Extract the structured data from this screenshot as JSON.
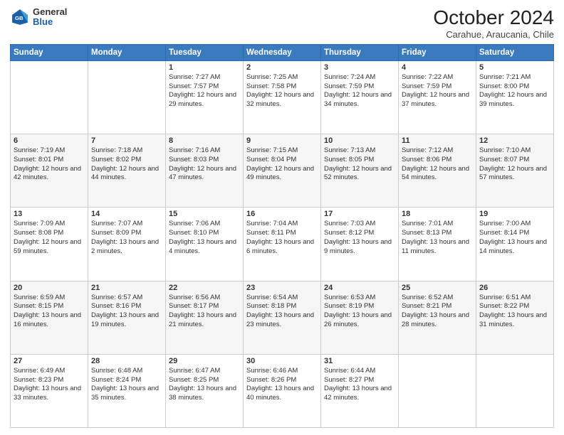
{
  "header": {
    "logo": {
      "line1": "General",
      "line2": "Blue"
    },
    "title": "October 2024",
    "subtitle": "Carahue, Araucania, Chile"
  },
  "weekdays": [
    "Sunday",
    "Monday",
    "Tuesday",
    "Wednesday",
    "Thursday",
    "Friday",
    "Saturday"
  ],
  "weeks": [
    [
      {
        "day": null,
        "sunrise": "",
        "sunset": "",
        "daylight": ""
      },
      {
        "day": null,
        "sunrise": "",
        "sunset": "",
        "daylight": ""
      },
      {
        "day": "1",
        "sunrise": "Sunrise: 7:27 AM",
        "sunset": "Sunset: 7:57 PM",
        "daylight": "Daylight: 12 hours and 29 minutes."
      },
      {
        "day": "2",
        "sunrise": "Sunrise: 7:25 AM",
        "sunset": "Sunset: 7:58 PM",
        "daylight": "Daylight: 12 hours and 32 minutes."
      },
      {
        "day": "3",
        "sunrise": "Sunrise: 7:24 AM",
        "sunset": "Sunset: 7:59 PM",
        "daylight": "Daylight: 12 hours and 34 minutes."
      },
      {
        "day": "4",
        "sunrise": "Sunrise: 7:22 AM",
        "sunset": "Sunset: 7:59 PM",
        "daylight": "Daylight: 12 hours and 37 minutes."
      },
      {
        "day": "5",
        "sunrise": "Sunrise: 7:21 AM",
        "sunset": "Sunset: 8:00 PM",
        "daylight": "Daylight: 12 hours and 39 minutes."
      }
    ],
    [
      {
        "day": "6",
        "sunrise": "Sunrise: 7:19 AM",
        "sunset": "Sunset: 8:01 PM",
        "daylight": "Daylight: 12 hours and 42 minutes."
      },
      {
        "day": "7",
        "sunrise": "Sunrise: 7:18 AM",
        "sunset": "Sunset: 8:02 PM",
        "daylight": "Daylight: 12 hours and 44 minutes."
      },
      {
        "day": "8",
        "sunrise": "Sunrise: 7:16 AM",
        "sunset": "Sunset: 8:03 PM",
        "daylight": "Daylight: 12 hours and 47 minutes."
      },
      {
        "day": "9",
        "sunrise": "Sunrise: 7:15 AM",
        "sunset": "Sunset: 8:04 PM",
        "daylight": "Daylight: 12 hours and 49 minutes."
      },
      {
        "day": "10",
        "sunrise": "Sunrise: 7:13 AM",
        "sunset": "Sunset: 8:05 PM",
        "daylight": "Daylight: 12 hours and 52 minutes."
      },
      {
        "day": "11",
        "sunrise": "Sunrise: 7:12 AM",
        "sunset": "Sunset: 8:06 PM",
        "daylight": "Daylight: 12 hours and 54 minutes."
      },
      {
        "day": "12",
        "sunrise": "Sunrise: 7:10 AM",
        "sunset": "Sunset: 8:07 PM",
        "daylight": "Daylight: 12 hours and 57 minutes."
      }
    ],
    [
      {
        "day": "13",
        "sunrise": "Sunrise: 7:09 AM",
        "sunset": "Sunset: 8:08 PM",
        "daylight": "Daylight: 12 hours and 59 minutes."
      },
      {
        "day": "14",
        "sunrise": "Sunrise: 7:07 AM",
        "sunset": "Sunset: 8:09 PM",
        "daylight": "Daylight: 13 hours and 2 minutes."
      },
      {
        "day": "15",
        "sunrise": "Sunrise: 7:06 AM",
        "sunset": "Sunset: 8:10 PM",
        "daylight": "Daylight: 13 hours and 4 minutes."
      },
      {
        "day": "16",
        "sunrise": "Sunrise: 7:04 AM",
        "sunset": "Sunset: 8:11 PM",
        "daylight": "Daylight: 13 hours and 6 minutes."
      },
      {
        "day": "17",
        "sunrise": "Sunrise: 7:03 AM",
        "sunset": "Sunset: 8:12 PM",
        "daylight": "Daylight: 13 hours and 9 minutes."
      },
      {
        "day": "18",
        "sunrise": "Sunrise: 7:01 AM",
        "sunset": "Sunset: 8:13 PM",
        "daylight": "Daylight: 13 hours and 11 minutes."
      },
      {
        "day": "19",
        "sunrise": "Sunrise: 7:00 AM",
        "sunset": "Sunset: 8:14 PM",
        "daylight": "Daylight: 13 hours and 14 minutes."
      }
    ],
    [
      {
        "day": "20",
        "sunrise": "Sunrise: 6:59 AM",
        "sunset": "Sunset: 8:15 PM",
        "daylight": "Daylight: 13 hours and 16 minutes."
      },
      {
        "day": "21",
        "sunrise": "Sunrise: 6:57 AM",
        "sunset": "Sunset: 8:16 PM",
        "daylight": "Daylight: 13 hours and 19 minutes."
      },
      {
        "day": "22",
        "sunrise": "Sunrise: 6:56 AM",
        "sunset": "Sunset: 8:17 PM",
        "daylight": "Daylight: 13 hours and 21 minutes."
      },
      {
        "day": "23",
        "sunrise": "Sunrise: 6:54 AM",
        "sunset": "Sunset: 8:18 PM",
        "daylight": "Daylight: 13 hours and 23 minutes."
      },
      {
        "day": "24",
        "sunrise": "Sunrise: 6:53 AM",
        "sunset": "Sunset: 8:19 PM",
        "daylight": "Daylight: 13 hours and 26 minutes."
      },
      {
        "day": "25",
        "sunrise": "Sunrise: 6:52 AM",
        "sunset": "Sunset: 8:21 PM",
        "daylight": "Daylight: 13 hours and 28 minutes."
      },
      {
        "day": "26",
        "sunrise": "Sunrise: 6:51 AM",
        "sunset": "Sunset: 8:22 PM",
        "daylight": "Daylight: 13 hours and 31 minutes."
      }
    ],
    [
      {
        "day": "27",
        "sunrise": "Sunrise: 6:49 AM",
        "sunset": "Sunset: 8:23 PM",
        "daylight": "Daylight: 13 hours and 33 minutes."
      },
      {
        "day": "28",
        "sunrise": "Sunrise: 6:48 AM",
        "sunset": "Sunset: 8:24 PM",
        "daylight": "Daylight: 13 hours and 35 minutes."
      },
      {
        "day": "29",
        "sunrise": "Sunrise: 6:47 AM",
        "sunset": "Sunset: 8:25 PM",
        "daylight": "Daylight: 13 hours and 38 minutes."
      },
      {
        "day": "30",
        "sunrise": "Sunrise: 6:46 AM",
        "sunset": "Sunset: 8:26 PM",
        "daylight": "Daylight: 13 hours and 40 minutes."
      },
      {
        "day": "31",
        "sunrise": "Sunrise: 6:44 AM",
        "sunset": "Sunset: 8:27 PM",
        "daylight": "Daylight: 13 hours and 42 minutes."
      },
      {
        "day": null,
        "sunrise": "",
        "sunset": "",
        "daylight": ""
      },
      {
        "day": null,
        "sunrise": "",
        "sunset": "",
        "daylight": ""
      }
    ]
  ]
}
